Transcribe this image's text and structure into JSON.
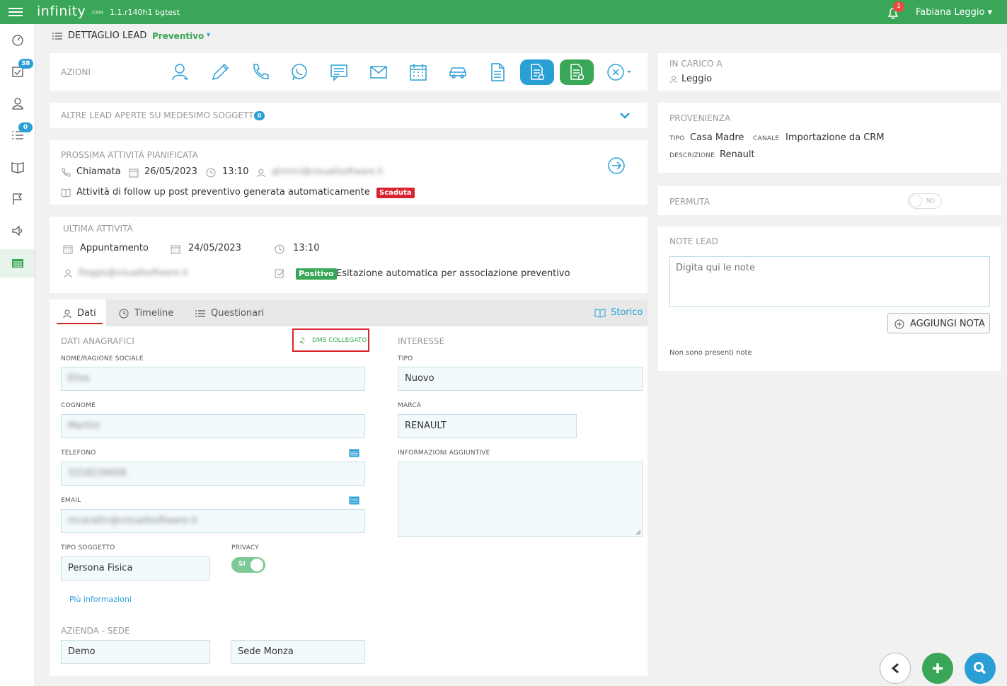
{
  "topbar": {
    "logo": "infinity",
    "logo_sub": "CRM",
    "version": "1.1.r140h1 bgtest",
    "notifications": "1",
    "user": "Fabiana Leggio"
  },
  "sidebar": {
    "badge_tasks": "38",
    "badge_list": "0"
  },
  "header": {
    "title": "DETTAGLIO LEAD",
    "status": "Preventivo"
  },
  "azioni": {
    "label": "AZIONI"
  },
  "altre_lead": {
    "label": "ALTRE LEAD APERTE SU MEDESIMO SOGGETTO",
    "count": "0"
  },
  "prossima": {
    "label": "PROSSIMA ATTIVITÀ PIANIFICATA",
    "type": "Chiamata",
    "date": "26/05/2023",
    "time": "13:10",
    "user": "gtrmrcl@visuallsoftware.it",
    "description": "Attività di follow up post preventivo generata automaticamente",
    "badge": "Scaduta"
  },
  "ultima": {
    "label": "ULTIMA ATTIVITÀ",
    "type": "Appuntamento",
    "date": "24/05/2023",
    "time": "13:10",
    "user": "fleggio@visuallsoftware.it",
    "badge": "Positivo",
    "description": "Esitazione automatica per associazione preventivo"
  },
  "tabs": {
    "dati": "Dati",
    "timeline": "Timeline",
    "questionari": "Questionari",
    "storico": "Storico"
  },
  "anagrafica": {
    "section": "DATI ANAGRAFICI",
    "dms": "DMS COLLEGATO",
    "nome_label": "NOME/RAGIONE SOCIALE",
    "nome_value": "Elisa",
    "cognome_label": "COGNOME",
    "cognome_value": "Martini",
    "telefono_label": "TELEFONO",
    "telefono_value": "3318239008",
    "email_label": "EMAIL",
    "email_value": "mcarattn@visuallsoftware.it",
    "tipo_soggetto_label": "TIPO SOGGETTO",
    "tipo_soggetto_value": "Persona Fisica",
    "privacy_label": "PRIVACY",
    "privacy_value": "SI",
    "piu_info": "Più informazioni",
    "azienda_label": "AZIENDA - SEDE",
    "azienda_value": "Demo",
    "sede_value": "Sede Monza"
  },
  "interesse": {
    "section": "INTERESSE",
    "tipo_label": "TIPO",
    "tipo_value": "Nuovo",
    "marca_label": "MARCA",
    "marca_value": "RENAULT",
    "info_label": "INFORMAZIONI AGGIUNTIVE",
    "info_value": ""
  },
  "in_carico": {
    "label": "IN CARICO A",
    "value": "Leggio"
  },
  "provenienza": {
    "label": "PROVENIENZA",
    "tipo_label": "TIPO",
    "tipo_value": "Casa Madre",
    "canale_label": "CANALE",
    "canale_value": "Importazione da CRM",
    "descr_label": "DESCRIZIONE",
    "descr_value": "Renault"
  },
  "permuta": {
    "label": "PERMUTA",
    "toggle": "NO"
  },
  "note": {
    "label": "NOTE LEAD",
    "placeholder": "Digita qui le note",
    "button": "AGGIUNGI NOTA",
    "empty": "Non sono presenti note"
  },
  "colors": {
    "green": "#3aa657",
    "blue": "#2a9fd6",
    "red": "#d9232e"
  }
}
